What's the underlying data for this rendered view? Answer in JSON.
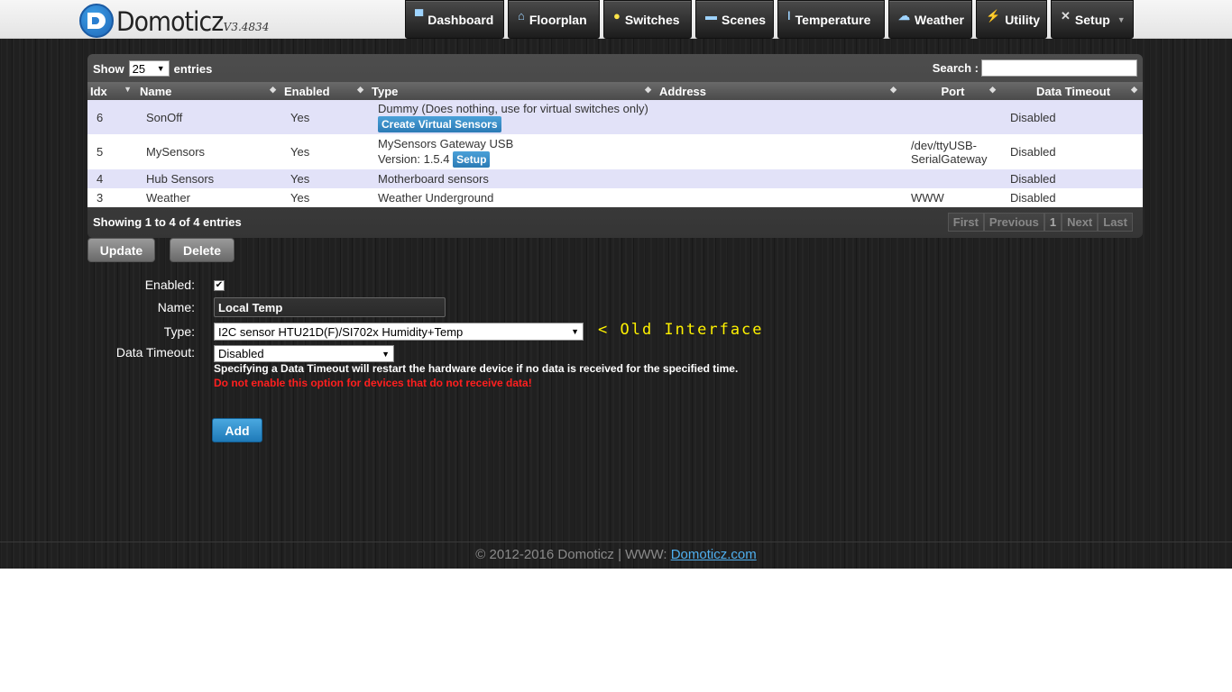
{
  "header": {
    "brand": "Domoticz",
    "version": "V3.4834",
    "nav": [
      {
        "label": "Dashboard",
        "icon": "monitor-icon"
      },
      {
        "label": "Floorplan",
        "icon": "floorplan-icon"
      },
      {
        "label": "Switches",
        "icon": "lightbulb-icon"
      },
      {
        "label": "Scenes",
        "icon": "clapperboard-icon"
      },
      {
        "label": "Temperature",
        "icon": "thermometer-icon"
      },
      {
        "label": "Weather",
        "icon": "cloud-rain-icon"
      },
      {
        "label": "Utility",
        "icon": "utility-icon"
      },
      {
        "label": "Setup",
        "icon": "tools-icon"
      }
    ]
  },
  "table": {
    "show_label": "Show",
    "entries_label": "entries",
    "page_size": "25",
    "search_label": "Search :",
    "columns": [
      "Idx",
      "Name",
      "Enabled",
      "Type",
      "Address",
      "Port",
      "Data Timeout"
    ],
    "rows": [
      {
        "idx": "6",
        "name": "SonOff",
        "enabled": "Yes",
        "type": "Dummy (Does nothing, use for virtual switches only)",
        "type_button": "Create Virtual Sensors",
        "address": "",
        "port": "",
        "timeout": "Disabled"
      },
      {
        "idx": "5",
        "name": "MySensors",
        "enabled": "Yes",
        "type": "MySensors Gateway USB",
        "type_line2": "Version: 1.5.4",
        "type_button": "Setup",
        "address": "",
        "port": "/dev/ttyUSB-SerialGateway",
        "timeout": "Disabled"
      },
      {
        "idx": "4",
        "name": "Hub Sensors",
        "enabled": "Yes",
        "type": "Motherboard sensors",
        "address": "",
        "port": "",
        "timeout": "Disabled"
      },
      {
        "idx": "3",
        "name": "Weather",
        "enabled": "Yes",
        "type": "Weather Underground",
        "address": "",
        "port": "WWW",
        "timeout": "Disabled"
      }
    ],
    "info": "Showing 1 to 4 of 4 entries",
    "pager": [
      "First",
      "Previous",
      "1",
      "Next",
      "Last"
    ]
  },
  "actions": {
    "update": "Update",
    "delete": "Delete"
  },
  "form": {
    "enabled_label": "Enabled:",
    "name_label": "Name:",
    "name_value": "Local Temp",
    "type_label": "Type:",
    "type_value": "I2C sensor HTU21D(F)/SI702x Humidity+Temp",
    "timeout_label": "Data Timeout:",
    "timeout_value": "Disabled",
    "note": "Specifying a Data Timeout will restart the hardware device if no data is received for the specified time.",
    "warning": "Do not enable this option for devices that do not receive data!",
    "add_label": "Add",
    "annotation": "< Old Interface"
  },
  "footer": {
    "text": "© 2012-2016 Domoticz | WWW: ",
    "link": "Domoticz.com"
  }
}
